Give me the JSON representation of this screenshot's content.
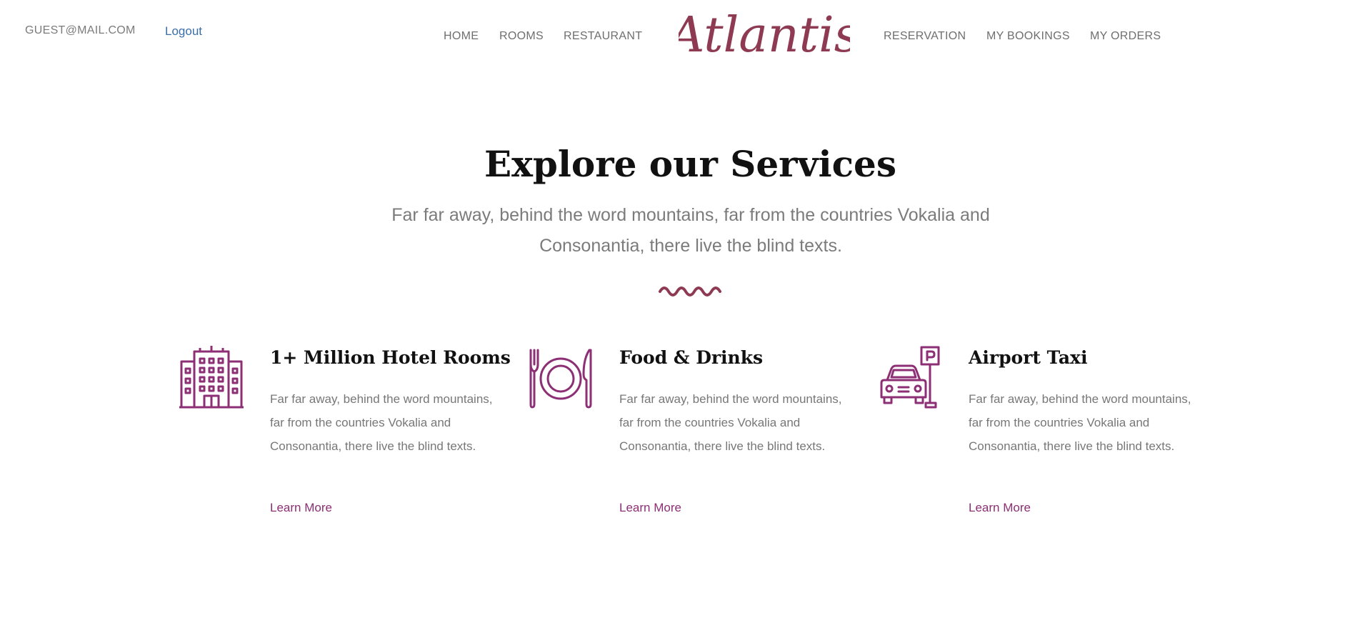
{
  "header": {
    "user_email": "GUEST@MAIL.COM",
    "logout_label": "Logout",
    "logo_text": "Atlantis",
    "nav_left": [
      "HOME",
      "ROOMS",
      "RESTAURANT"
    ],
    "nav_right": [
      "RESERVATION",
      "MY BOOKINGS",
      "MY ORDERS"
    ]
  },
  "section": {
    "title": "Explore our Services",
    "subtitle": "Far far away, behind the word mountains, far from the countries Vokalia and Consonantia, there live the blind texts."
  },
  "services": [
    {
      "icon": "hotel-building-icon",
      "title": "1+ Million Hotel Rooms",
      "text": "Far far away, behind the word mountains, far from the countries Vokalia and Consonantia, there live the blind texts.",
      "link": "Learn More"
    },
    {
      "icon": "plate-fork-knife-icon",
      "title": "Food & Drinks",
      "text": "Far far away, behind the word mountains, far from the countries Vokalia and Consonantia, there live the blind texts.",
      "link": "Learn More"
    },
    {
      "icon": "car-parking-icon",
      "title": "Airport Taxi",
      "text": "Far far away, behind the word mountains, far from the countries Vokalia and Consonantia, there live the blind texts.",
      "link": "Learn More"
    }
  ],
  "colors": {
    "accent": "#8c2f74",
    "logo": "#8e3a52",
    "link_blue": "#3a6fa8",
    "muted_text": "#7b7b7b"
  }
}
